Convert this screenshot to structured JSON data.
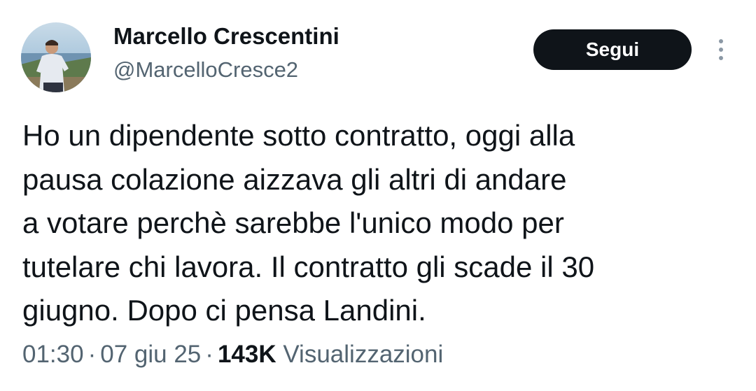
{
  "author": {
    "display_name": "Marcello Crescentini",
    "handle": "@MarcelloCresce2"
  },
  "actions": {
    "follow_label": "Segui",
    "more_icon": "more-vertical-icon"
  },
  "tweet": {
    "lines": [
      "Ho un dipendente sotto contratto, oggi alla",
      "pausa colazione aizzava gli altri di andare",
      "a votare perchè sarebbe l'unico modo per",
      "tutelare chi lavora. Il contratto gli scade il 30",
      "giugno. Dopo ci pensa Landini."
    ]
  },
  "meta": {
    "time": "01:30",
    "separator": "·",
    "date": "07 giu 25",
    "views_count": "143K",
    "views_label": "Visualizzazioni"
  },
  "colors": {
    "text_primary": "#0f1419",
    "text_secondary": "#536471",
    "button_bg": "#0f1419",
    "button_text": "#ffffff"
  }
}
